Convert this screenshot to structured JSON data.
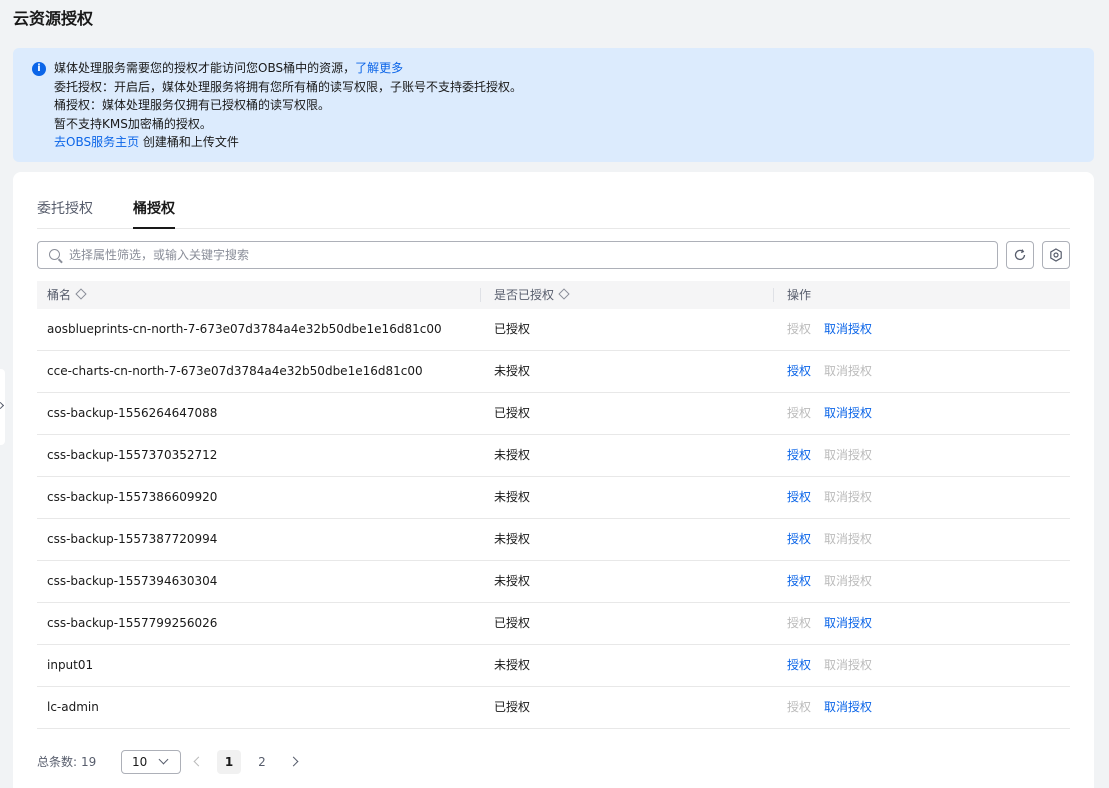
{
  "page": {
    "title": "云资源授权"
  },
  "notice": {
    "line1_text": "媒体处理服务需要您的授权才能访问您OBS桶中的资源，",
    "line1_link": "了解更多",
    "line2": "委托授权：开启后，媒体处理服务将拥有您所有桶的读写权限，子账号不支持委托授权。",
    "line3": "桶授权：媒体处理服务仅拥有已授权桶的读写权限。",
    "line4": "暂不支持KMS加密桶的授权。",
    "line5_link": "去OBS服务主页",
    "line5_text": " 创建桶和上传文件"
  },
  "tabs": [
    {
      "label": "委托授权",
      "active": false
    },
    {
      "label": "桶授权",
      "active": true
    }
  ],
  "search": {
    "placeholder": "选择属性筛选，或输入关键字搜索",
    "value": ""
  },
  "table": {
    "columns": [
      "桶名",
      "是否已授权",
      "操作"
    ],
    "grant_label": "授权",
    "revoke_label": "取消授权",
    "rows": [
      {
        "name": "aosblueprints-cn-north-7-673e07d3784a4e32b50dbe1e16d81c00",
        "status": "已授权",
        "authorized": true
      },
      {
        "name": "cce-charts-cn-north-7-673e07d3784a4e32b50dbe1e16d81c00",
        "status": "未授权",
        "authorized": false
      },
      {
        "name": "css-backup-1556264647088",
        "status": "已授权",
        "authorized": true
      },
      {
        "name": "css-backup-1557370352712",
        "status": "未授权",
        "authorized": false
      },
      {
        "name": "css-backup-1557386609920",
        "status": "未授权",
        "authorized": false
      },
      {
        "name": "css-backup-1557387720994",
        "status": "未授权",
        "authorized": false
      },
      {
        "name": "css-backup-1557394630304",
        "status": "未授权",
        "authorized": false
      },
      {
        "name": "css-backup-1557799256026",
        "status": "已授权",
        "authorized": true
      },
      {
        "name": "input01",
        "status": "未授权",
        "authorized": false
      },
      {
        "name": "lc-admin",
        "status": "已授权",
        "authorized": true
      }
    ]
  },
  "pagination": {
    "total_label": "总条数:",
    "total": "19",
    "page_size": "10",
    "pages": [
      "1",
      "2"
    ],
    "current": "1"
  },
  "colors": {
    "accent": "#0b65e8",
    "notice_bg": "#dcebfd",
    "disabled": "#bbbbbb"
  }
}
